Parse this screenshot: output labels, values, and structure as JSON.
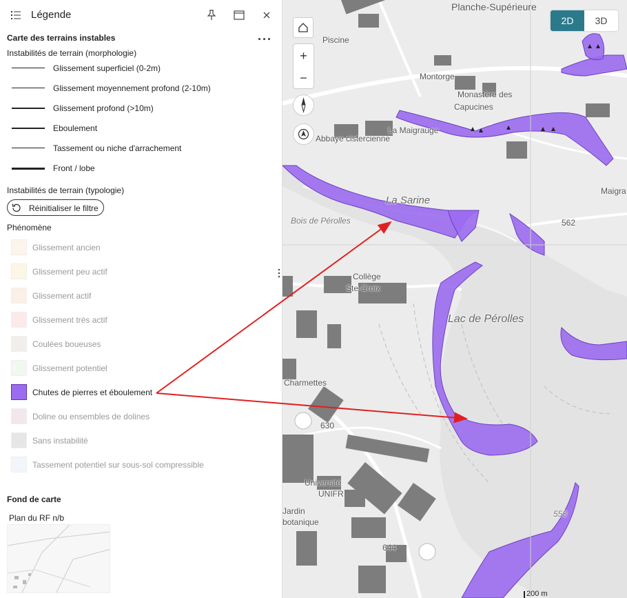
{
  "panel": {
    "title": "Légende",
    "header_icons": [
      "legend-list-icon",
      "pin-icon",
      "window-icon",
      "close-icon"
    ]
  },
  "legend": {
    "layer_title": "Carte des terrains instables",
    "morphology_title": "Instabilités de terrain (morphologie)",
    "line_items": [
      {
        "label": "Glissement superficiel (0-2m)",
        "weight": 1
      },
      {
        "label": "Glissement moyennement profond (2-10m)",
        "weight": 1
      },
      {
        "label": "Glissement profond (>10m)",
        "weight": 2
      },
      {
        "label": "Eboulement",
        "weight": 2
      },
      {
        "label": "Tassement ou niche d'arrachement",
        "weight": 1
      },
      {
        "label": "Front / lobe",
        "weight": 3
      }
    ],
    "typology_title": "Instabilités de terrain (typologie)",
    "reset_label": "Réinitialiser le filtre",
    "phenomenon_title": "Phénomène",
    "phenomena": [
      {
        "label": "Glissement ancien",
        "color": "#fbf5ec",
        "active": false
      },
      {
        "label": "Glissement peu actif",
        "color": "#fcf6e4",
        "active": false
      },
      {
        "label": "Glissement actif",
        "color": "#fcefe6",
        "active": false
      },
      {
        "label": "Glissement très actif",
        "color": "#fce9e9",
        "active": false
      },
      {
        "label": "Coulées boueuses",
        "color": "#f1eeeb",
        "active": false
      },
      {
        "label": "Glissement potentiel",
        "color": "#f0f8f0",
        "active": false
      },
      {
        "label": "Chutes de pierres et éboulement",
        "color": "#9b6cf0",
        "active": true
      },
      {
        "label": "Doline ou ensembles de dolines",
        "color": "#f3e7ee",
        "active": false
      },
      {
        "label": "Sans instabilité",
        "color": "#e6e6e6",
        "active": false
      },
      {
        "label": "Tassement potentiel sur sous-sol compressible",
        "color": "#f2f6fa",
        "active": false
      }
    ],
    "basemap_title": "Fond de carte",
    "basemap_name": "Plan du RF n/b"
  },
  "map": {
    "labels": {
      "planche": "Planche-Supérieure",
      "piscine": "Piscine",
      "montorge": "Montorge",
      "monastere1": "Monastère des",
      "monastere2": "Capucines",
      "maigrauge": "La Maigrauge",
      "abbaye": "Abbaye cistercienne",
      "sarine": "La Sarine",
      "bois": "Bois de Pérolles",
      "college1": "Collège",
      "college2": "Ste-Croix",
      "lac": "Lac de Pérolles",
      "charmettes": "Charmettes",
      "universite1": "Université",
      "universite2": "UNIFR",
      "jardin1": "Jardin",
      "jardin2": "botanique",
      "maigr_right": "Maigra",
      "alt562": "562",
      "alt630": "630",
      "alt644": "644",
      "alt553": "553"
    },
    "view_toggle": {
      "active": "2D",
      "inactive": "3D"
    },
    "controls": [
      "home-icon",
      "zoom-in-icon",
      "zoom-out-icon",
      "compass-icon",
      "locate-icon"
    ],
    "zoom_in": "+",
    "zoom_out": "−",
    "scale": "200 m",
    "hazard_color": "#9b6cf0",
    "arrow_color": "#e02020"
  }
}
